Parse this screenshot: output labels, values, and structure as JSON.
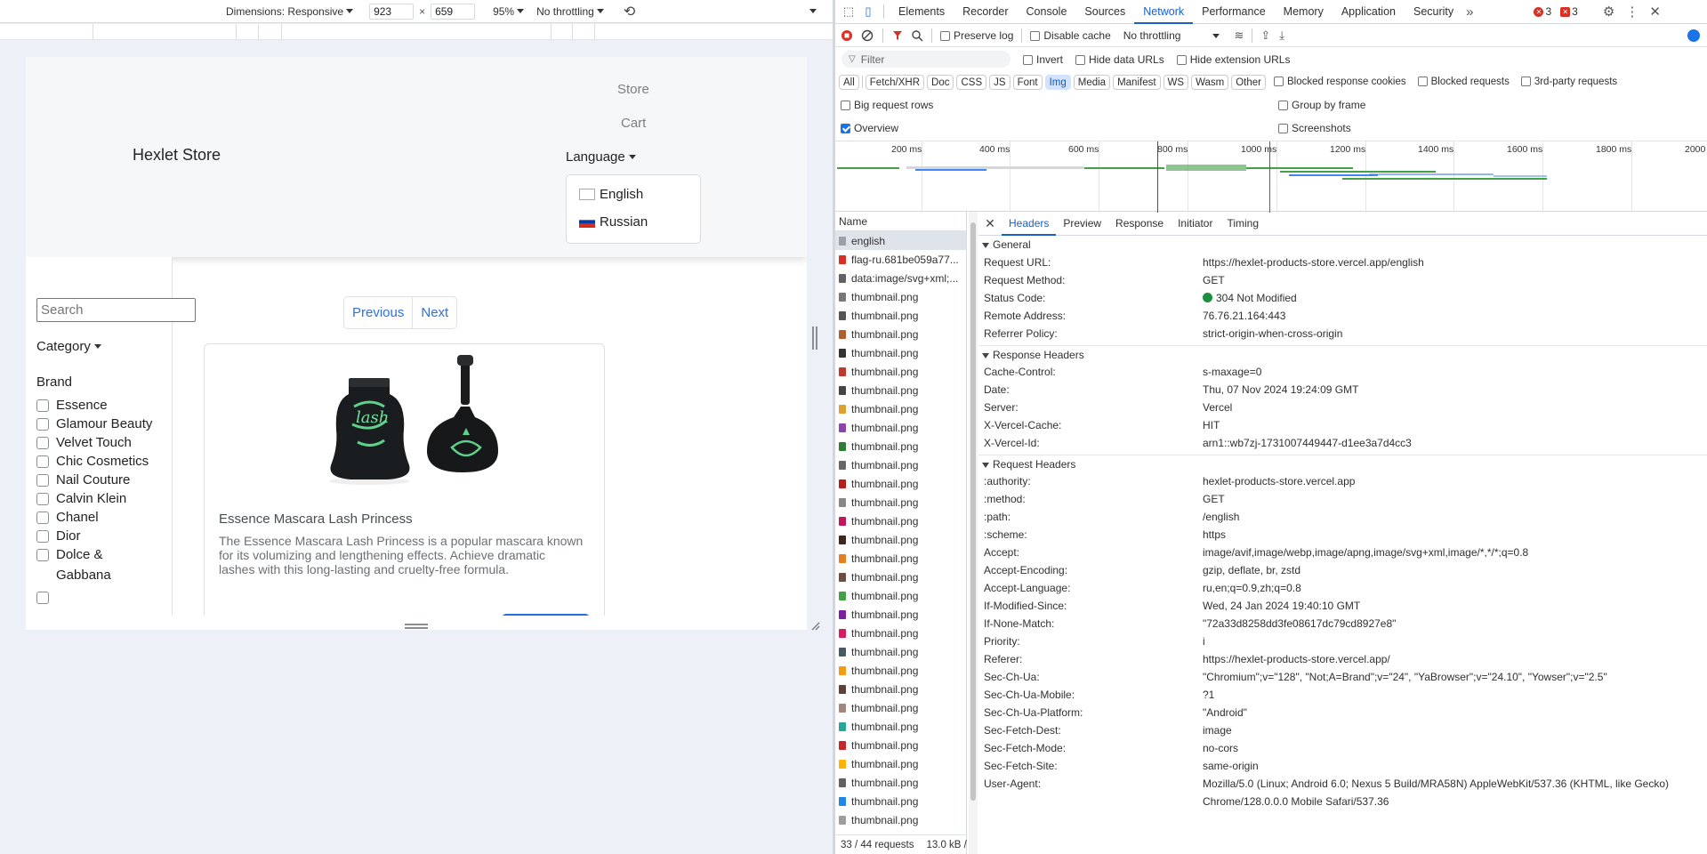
{
  "device_toolbar": {
    "dimensions_label": "Dimensions: Responsive",
    "width": "923",
    "times": "×",
    "height": "659",
    "zoom": "95%",
    "throttling": "No throttling"
  },
  "store": {
    "brand": "Hexlet Store",
    "nav": {
      "store": "Store",
      "cart": "Cart",
      "language": "Language"
    },
    "languages": [
      "English",
      "Russian"
    ],
    "search_placeholder": "Search",
    "category": "Category",
    "brand_heading": "Brand",
    "brands": [
      "Essence",
      "Glamour Beauty",
      "Velvet Touch",
      "Chic Cosmetics",
      "Nail Couture",
      "Calvin Klein",
      "Chanel",
      "Dior",
      "Dolce & Gabbana"
    ],
    "pager": {
      "previous": "Previous",
      "next": "Next"
    },
    "product": {
      "title": "Essence Mascara Lash Princess",
      "description": "The Essence Mascara Lash Princess is a popular mascara known for its volumizing and lengthening effects. Achieve dramatic lashes with this long-lasting and cruelty-free formula."
    }
  },
  "devtools": {
    "tabs": [
      "Elements",
      "Recorder",
      "Console",
      "Sources",
      "Network",
      "Performance",
      "Memory",
      "Application",
      "Security"
    ],
    "active_tab": "Network",
    "errors": "3",
    "warnings": "3",
    "toolbar": {
      "preserve_log": "Preserve log",
      "disable_cache": "Disable cache",
      "throttling": "No throttling"
    },
    "filter": {
      "placeholder": "Filter",
      "invert": "Invert",
      "hide_data_urls": "Hide data URLs",
      "hide_ext_urls": "Hide extension URLs"
    },
    "types": [
      "All",
      "Fetch/XHR",
      "Doc",
      "CSS",
      "JS",
      "Font",
      "Img",
      "Media",
      "Manifest",
      "WS",
      "Wasm",
      "Other"
    ],
    "active_type": "Img",
    "type_checks": {
      "blocked_cookies": "Blocked response cookies",
      "blocked_requests": "Blocked requests",
      "third_party": "3rd-party requests"
    },
    "options": {
      "big_rows": "Big request rows",
      "group_frame": "Group by frame",
      "overview": "Overview",
      "screenshots": "Screenshots"
    },
    "timeline_labels": [
      "200 ms",
      "400 ms",
      "600 ms",
      "800 ms",
      "1000 ms",
      "1200 ms",
      "1400 ms",
      "1600 ms",
      "1800 ms",
      "2000"
    ],
    "name_header": "Name",
    "requests": [
      "english",
      "flag-ru.681be059a77...",
      "data:image/svg+xml;...",
      "thumbnail.png",
      "thumbnail.png",
      "thumbnail.png",
      "thumbnail.png",
      "thumbnail.png",
      "thumbnail.png",
      "thumbnail.png",
      "thumbnail.png",
      "thumbnail.png",
      "thumbnail.png",
      "thumbnail.png",
      "thumbnail.png",
      "thumbnail.png",
      "thumbnail.png",
      "thumbnail.png",
      "thumbnail.png",
      "thumbnail.png",
      "thumbnail.png",
      "thumbnail.png",
      "thumbnail.png",
      "thumbnail.png",
      "thumbnail.png",
      "thumbnail.png",
      "thumbnail.png",
      "thumbnail.png",
      "thumbnail.png",
      "thumbnail.png",
      "thumbnail.png",
      "thumbnail.png"
    ],
    "footer": {
      "requests": "33 / 44 requests",
      "size": "13.0 kB /"
    },
    "detail_tabs": [
      "Headers",
      "Preview",
      "Response",
      "Initiator",
      "Timing"
    ],
    "general_title": "General",
    "general": [
      {
        "k": "Request URL:",
        "v": "https://hexlet-products-store.vercel.app/english"
      },
      {
        "k": "Request Method:",
        "v": "GET"
      },
      {
        "k": "Status Code:",
        "v": "304 Not Modified"
      },
      {
        "k": "Remote Address:",
        "v": "76.76.21.164:443"
      },
      {
        "k": "Referrer Policy:",
        "v": "strict-origin-when-cross-origin"
      }
    ],
    "response_title": "Response Headers",
    "response_headers": [
      {
        "k": "Cache-Control:",
        "v": "s-maxage=0"
      },
      {
        "k": "Date:",
        "v": "Thu, 07 Nov 2024 19:24:09 GMT"
      },
      {
        "k": "Server:",
        "v": "Vercel"
      },
      {
        "k": "X-Vercel-Cache:",
        "v": "HIT"
      },
      {
        "k": "X-Vercel-Id:",
        "v": "arn1::wb7zj-1731007449447-d1ee3a7d4cc3"
      }
    ],
    "request_title": "Request Headers",
    "request_headers": [
      {
        "k": ":authority:",
        "v": "hexlet-products-store.vercel.app"
      },
      {
        "k": ":method:",
        "v": "GET"
      },
      {
        "k": ":path:",
        "v": "/english"
      },
      {
        "k": ":scheme:",
        "v": "https"
      },
      {
        "k": "Accept:",
        "v": "image/avif,image/webp,image/apng,image/svg+xml,image/*,*/*;q=0.8"
      },
      {
        "k": "Accept-Encoding:",
        "v": "gzip, deflate, br, zstd"
      },
      {
        "k": "Accept-Language:",
        "v": "ru,en;q=0.9,zh;q=0.8"
      },
      {
        "k": "If-Modified-Since:",
        "v": "Wed, 24 Jan 2024 19:40:10 GMT"
      },
      {
        "k": "If-None-Match:",
        "v": "\"72a33d8258dd3fe08617dc79cd8927e8\""
      },
      {
        "k": "Priority:",
        "v": "i"
      },
      {
        "k": "Referer:",
        "v": "https://hexlet-products-store.vercel.app/"
      },
      {
        "k": "Sec-Ch-Ua:",
        "v": "\"Chromium\";v=\"128\", \"Not;A=Brand\";v=\"24\", \"YaBrowser\";v=\"24.10\", \"Yowser\";v=\"2.5\""
      },
      {
        "k": "Sec-Ch-Ua-Mobile:",
        "v": "?1"
      },
      {
        "k": "Sec-Ch-Ua-Platform:",
        "v": "\"Android\""
      },
      {
        "k": "Sec-Fetch-Dest:",
        "v": "image"
      },
      {
        "k": "Sec-Fetch-Mode:",
        "v": "no-cors"
      },
      {
        "k": "Sec-Fetch-Site:",
        "v": "same-origin"
      },
      {
        "k": "User-Agent:",
        "v": "Mozilla/5.0 (Linux; Android 6.0; Nexus 5 Build/MRA58N) AppleWebKit/537.36 (KHTML, like Gecko)"
      },
      {
        "k": "",
        "v": "Chrome/128.0.0.0 Mobile Safari/537.36"
      }
    ]
  }
}
